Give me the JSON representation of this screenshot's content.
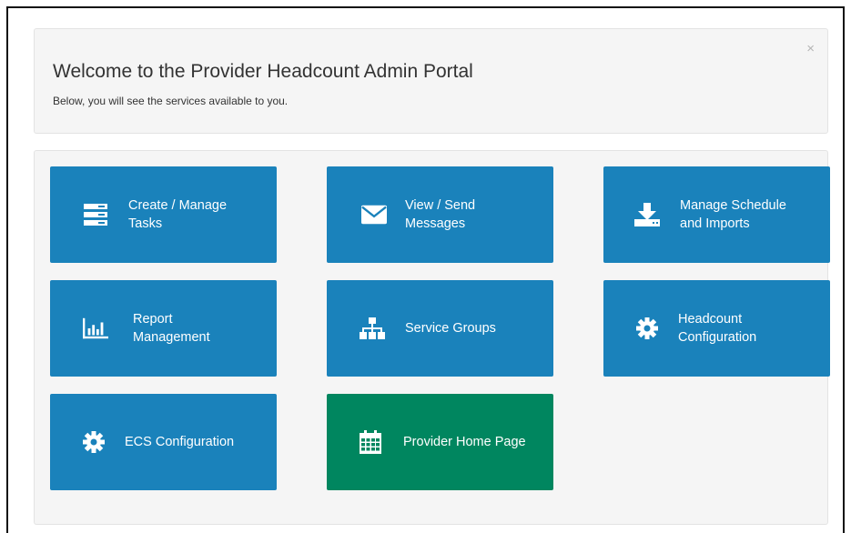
{
  "welcome": {
    "title": "Welcome to the Provider Headcount Admin Portal",
    "subtitle": "Below, you will see the services available to you.",
    "close": "×"
  },
  "tiles": [
    {
      "label": "Create / Manage\nTasks",
      "icon": "server-stack-icon",
      "color": "#1a82bb"
    },
    {
      "label": "View / Send\nMessages",
      "icon": "envelope-icon",
      "color": "#1a82bb"
    },
    {
      "label": "Manage Schedule\nand Imports",
      "icon": "download-icon",
      "color": "#1a82bb"
    },
    {
      "label": "Report\nManagement",
      "icon": "bar-chart-icon",
      "color": "#1a82bb"
    },
    {
      "label": "Service Groups",
      "icon": "sitemap-icon",
      "color": "#1a82bb"
    },
    {
      "label": "Headcount\nConfiguration",
      "icon": "gear-icon",
      "color": "#1a82bb"
    },
    {
      "label": "ECS Configuration",
      "icon": "gear-icon",
      "color": "#1a82bb"
    },
    {
      "label": "Provider Home Page",
      "icon": "calendar-icon",
      "color": "#00865f"
    }
  ]
}
